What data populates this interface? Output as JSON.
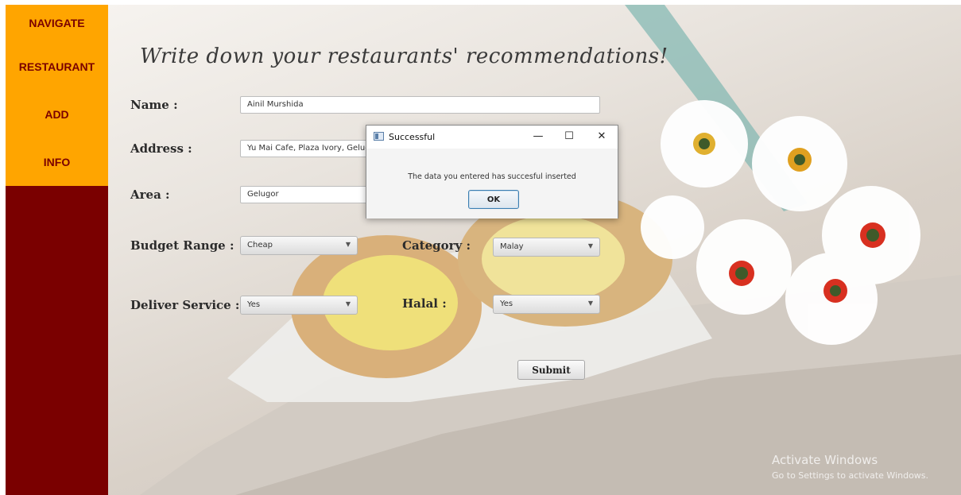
{
  "sidebar": {
    "items": [
      {
        "label": "NAVIGATE"
      },
      {
        "label": "RESTAURANT"
      },
      {
        "label": "ADD"
      },
      {
        "label": "INFO"
      }
    ]
  },
  "form": {
    "heading": "Write down your restaurants' recommendations!",
    "name_label": "Name  :",
    "name_value": "Ainil Murshida",
    "address_label": "Address :",
    "address_value": "Yu Mai Cafe, Plaza Ivory, Gelugor",
    "area_label": "Area :",
    "area_value": "Gelugor",
    "budget_label": "Budget Range :",
    "budget_value": "Cheap",
    "category_label": "Category :",
    "category_value": "Malay",
    "deliver_label": "Deliver Service :",
    "deliver_value": "Yes",
    "halal_label": "Halal :",
    "halal_value": "Yes",
    "submit_label": "Submit"
  },
  "dialog": {
    "title": "Successful",
    "message": "The data you entered has succesful inserted",
    "ok_label": "OK",
    "min_glyph": "—",
    "max_glyph": "☐",
    "close_glyph": "✕"
  },
  "watermark": {
    "line1": "Activate Windows",
    "line2": "Go to Settings to activate Windows."
  },
  "colors": {
    "sidebar_bg": "#7a0000",
    "nav_bg": "#ffa500",
    "nav_text": "#7a0000"
  }
}
